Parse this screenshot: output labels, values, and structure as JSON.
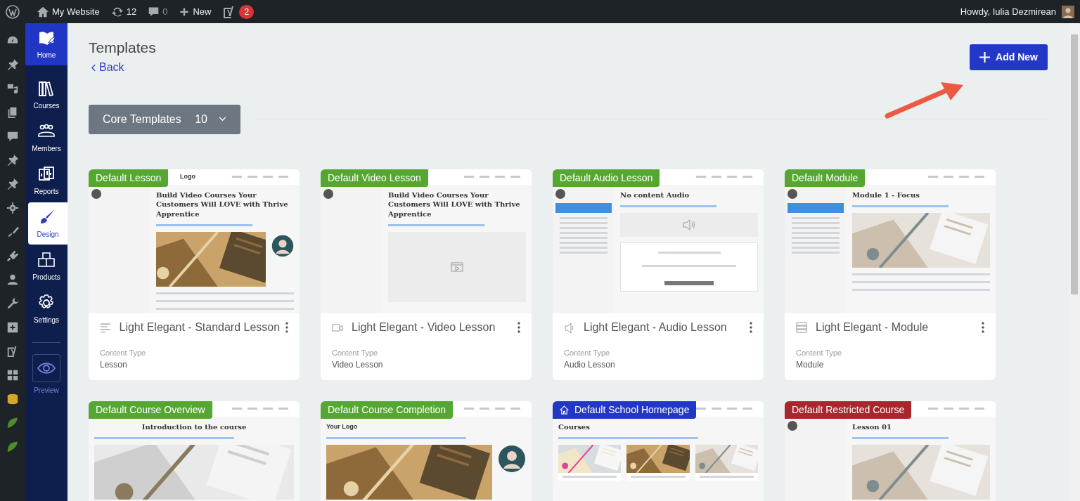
{
  "admin_bar": {
    "site_name": "My Website",
    "updates": "12",
    "comments": "0",
    "new_label": "New",
    "seo_badge": "2",
    "greeting": "Howdy, Iulia Dezmirean"
  },
  "nav": [
    {
      "label": "Home",
      "kind": "home",
      "selected": false
    },
    {
      "label": "Courses",
      "kind": "courses",
      "selected": false
    },
    {
      "label": "Members",
      "kind": "members",
      "selected": false
    },
    {
      "label": "Reports",
      "kind": "reports",
      "selected": false
    },
    {
      "label": "Design",
      "kind": "design",
      "selected": true
    },
    {
      "label": "Products",
      "kind": "products",
      "selected": false
    },
    {
      "label": "Settings",
      "kind": "settings",
      "selected": false
    },
    {
      "label": "Preview",
      "kind": "preview",
      "selected": false
    }
  ],
  "page": {
    "title": "Templates",
    "back": "Back",
    "add_button": "Add New"
  },
  "filter": {
    "label": "Core Templates",
    "count": "10"
  },
  "cards": [
    {
      "kind": "lesson",
      "tag": "Default Lesson",
      "color": "#56a632",
      "title": "Light Elegant - Standard Lesson",
      "content_type_label": "Content Type",
      "content_type": "Lesson",
      "preview": {
        "logo": "Logo",
        "heading": "Build Video Courses Your Customers Will LOVE with Thrive Apprentice"
      }
    },
    {
      "kind": "video",
      "tag": "Default Video Lesson",
      "color": "#56a632",
      "title": "Light Elegant - Video Lesson",
      "content_type_label": "Content Type",
      "content_type": "Video Lesson",
      "preview": {
        "heading": "Build Video Courses Your Customers Will LOVE with Thrive Apprentice"
      }
    },
    {
      "kind": "audio",
      "tag": "Default Audio Lesson",
      "color": "#56a632",
      "title": "Light Elegant - Audio Lesson",
      "content_type_label": "Content Type",
      "content_type": "Audio Lesson",
      "preview": {
        "heading": "No content Audio"
      }
    },
    {
      "kind": "module",
      "tag": "Default Module",
      "color": "#56a632",
      "title": "Light Elegant - Module",
      "content_type_label": "Content Type",
      "content_type": "Module",
      "preview": {
        "heading": "Module 1 - Focus"
      }
    },
    {
      "kind": "overview",
      "tag": "Default Course Overview",
      "color": "#56a632",
      "preview": {
        "heading": "Introduction to the course"
      }
    },
    {
      "kind": "completion",
      "tag": "Default Course Completion",
      "color": "#56a632",
      "preview": {
        "logo": "Your Logo"
      }
    },
    {
      "kind": "school",
      "tag": "Default School Homepage",
      "color": "#2337c6",
      "preview": {
        "heading": "Courses"
      }
    },
    {
      "kind": "restricted",
      "tag": "Default Restricted Course",
      "color": "#a8262d",
      "preview": {
        "heading": "Lesson 01"
      }
    }
  ]
}
